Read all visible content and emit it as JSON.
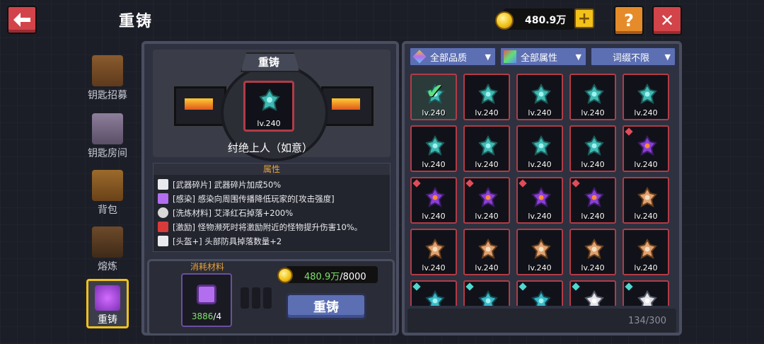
{
  "header": {
    "title": "重铸",
    "currency_value": "480.9万"
  },
  "nav": [
    {
      "label": "钥匙招募",
      "icon": "chest-icon"
    },
    {
      "label": "钥匙房间",
      "icon": "door-icon"
    },
    {
      "label": "背包",
      "icon": "backpack-icon"
    },
    {
      "label": "熔炼",
      "icon": "furnace-icon"
    },
    {
      "label": "重铸",
      "icon": "reforge-icon",
      "active": true
    }
  ],
  "reforge": {
    "panel_title": "重铸",
    "item_level": "lv.240",
    "item_name": "纣绝上人（如意）",
    "attributes_title": "属性",
    "attributes": [
      {
        "text": "[武器碎片] 武器碎片加成50%",
        "icon": "shard-icon"
      },
      {
        "text": "[感染] 感染向周围传播降低玩家的[攻击强度]",
        "icon": "infection-icon"
      },
      {
        "text": "[洗炼材料] 艾泽红石掉落+200%",
        "icon": "gear-icon"
      },
      {
        "text": "[激励] 怪物濒死时将激励附近的怪物提升伤害10%。",
        "icon": "demon-icon"
      },
      {
        "text": "[头盔+] 头部防具掉落数量+2",
        "icon": "helmet-icon"
      }
    ],
    "cost_title": "消耗材料",
    "material_count": "3886",
    "material_need": "/4",
    "gold_have": "480.9万",
    "gold_need": "/8000",
    "button_label": "重铸"
  },
  "filters": {
    "quality": "全部品质",
    "attribute": "全部属性",
    "affix": "词缀不限"
  },
  "grid": {
    "count_label": "134/300",
    "level": "lv.240",
    "rows": [
      [
        "teal-check",
        "teal",
        "teal",
        "teal",
        "teal"
      ],
      [
        "teal",
        "teal",
        "teal",
        "teal",
        "purple"
      ],
      [
        "purple",
        "purple",
        "purple",
        "purple",
        "gold"
      ],
      [
        "gold",
        "gold",
        "gold",
        "gold",
        "gold"
      ],
      [
        "cyan",
        "cyan",
        "cyan",
        "white",
        "white"
      ]
    ]
  },
  "colors": {
    "accent_blue": "#5c6fb3",
    "red_frame": "#b23b46",
    "gold": "#f2c21a",
    "attr_title": "#e7a43a"
  }
}
